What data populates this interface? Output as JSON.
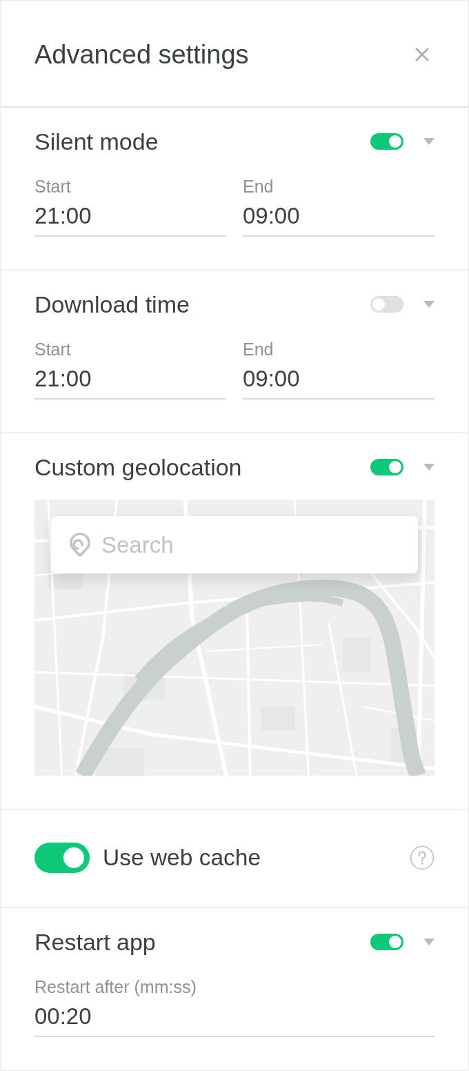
{
  "header": {
    "title": "Advanced settings"
  },
  "sections": [
    {
      "kind": "fields",
      "title": "Silent mode",
      "on": true,
      "fields": [
        {
          "label": "Start",
          "value": "21:00"
        },
        {
          "label": "End",
          "value": "09:00"
        }
      ]
    },
    {
      "kind": "fields",
      "title": "Download time",
      "on": false,
      "fields": [
        {
          "label": "Start",
          "value": "21:00"
        },
        {
          "label": "End",
          "value": "09:00"
        }
      ]
    },
    {
      "kind": "map",
      "title": "Custom geolocation",
      "on": true,
      "search": {
        "placeholder": "Search"
      }
    },
    {
      "kind": "switch",
      "label": "Use web cache",
      "on": true
    },
    {
      "kind": "fields",
      "title": "Restart app",
      "on": true,
      "fields": [
        {
          "label": "Restart after (mm:ss)",
          "value": "00:20"
        }
      ]
    }
  ]
}
